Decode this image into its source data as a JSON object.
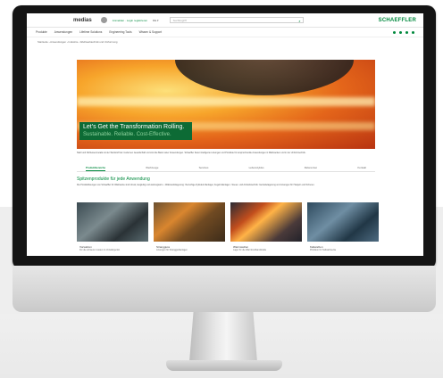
{
  "header": {
    "site_name": "medias",
    "login_text": "Anmelden · Login registrieren",
    "language": "DE ▾",
    "search_placeholder": "Suchbegriff",
    "brand": "SCHAEFFLER"
  },
  "nav": {
    "items": [
      "Produkte",
      "Anwendungen",
      "Lifetime Solutions",
      "Engineering Tools",
      "Wissen & Support"
    ]
  },
  "breadcrumb": "Startseite › Anwendungen › Industrie › Walzwerktechnik und Umformung",
  "hero": {
    "headline": "Let's Get the Transformation Rolling.",
    "tagline": "Sustainable. Reliable. Cost-Effective."
  },
  "intro": "Stahl und Nichteisenmetalle ist der Werkstoff der modernen Gesellschaft und sind die Basis vieler Anwendungen. Schaeffler bietet intelligente Lösungen und Produkte für anspruchsvolle Anwendungen in Walzwerken und in der Umformtechnik.",
  "tabs": [
    "Produktbereiche",
    "Werkzeuge",
    "Services",
    "Lebenszyklus",
    "Referenzen",
    "Kontakt"
  ],
  "section": {
    "title": "Spitzenprodukte für jede Anwendung",
    "text": "Die Produktlösungen von Schaeffler für Walzwerke sind robust, langlebig und wartungsarm. • Walzwerkslagerung: Vierreihige Zylinderrollenlager, Kegelrollenlager • Steuer- und Antriebstechnik: Getriebelagerung und Lösungen für Haspeln und Scheren."
  },
  "cards": [
    {
      "title": "Vorwalzen",
      "desc": "Für die schweren Lasten im Vorwalzgerüst"
    },
    {
      "title": "Strangguss",
      "desc": "Lösungen für Stranggießanlagen"
    },
    {
      "title": "Warmwalzen",
      "desc": "Lager für die Warmbreitbandstraße"
    },
    {
      "title": "Kaltwalzen",
      "desc": "Präzision für Kaltwalzwerke"
    }
  ],
  "colors": {
    "accent": "#00893d",
    "bezel": "#141414"
  }
}
